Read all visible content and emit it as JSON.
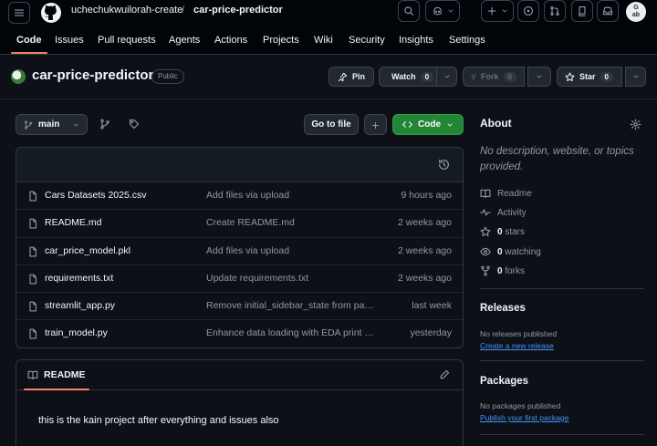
{
  "header": {
    "owner": "uchechukwuilorah-create",
    "separator": "/",
    "repo": "car-price-predictor",
    "avatar_lines": [
      "G",
      "ab"
    ]
  },
  "nav": {
    "tabs": [
      "Code",
      "Issues",
      "Pull requests",
      "Agents",
      "Actions",
      "Projects",
      "Wiki",
      "Security",
      "Insights",
      "Settings"
    ],
    "active": "Code"
  },
  "repo": {
    "name": "car-price-predictor",
    "visibility": "Public",
    "pin_label": "Pin",
    "watch_label": "Watch",
    "watch_count": "0",
    "fork_label": "Fork",
    "fork_count": "0",
    "star_label": "Star",
    "star_count": "0"
  },
  "toolbar": {
    "branch": "main",
    "goto_file": "Go to file",
    "plus": "+",
    "code_label": "Code"
  },
  "files": [
    {
      "name": "Cars Datasets 2025.csv",
      "message": "Add files via upload",
      "date": "9 hours ago"
    },
    {
      "name": "README.md",
      "message": "Create README.md",
      "date": "2 weeks ago"
    },
    {
      "name": "car_price_model.pkl",
      "message": "Add files via upload",
      "date": "2 weeks ago"
    },
    {
      "name": "requirements.txt",
      "message": "Update requirements.txt",
      "date": "2 weeks ago"
    },
    {
      "name": "streamlit_app.py",
      "message": "Remove initial_sidebar_state from page config",
      "date": "last week"
    },
    {
      "name": "train_model.py",
      "message": "Enhance data loading with EDA print statements",
      "date": "yesterday"
    }
  ],
  "readme": {
    "tab_label": "README",
    "body": "this is the kain project after everything and issues also"
  },
  "sidebar": {
    "about_title": "About",
    "about_desc": "No description, website, or topics provided.",
    "readme_link": "Readme",
    "activity_link": "Activity",
    "stars_count": "0",
    "stars_label": "stars",
    "watching_count": "0",
    "watching_label": "watching",
    "forks_count": "0",
    "forks_label": "forks",
    "releases_title": "Releases",
    "releases_note": "No releases published",
    "releases_link": "Create a new release",
    "packages_title": "Packages",
    "packages_note": "No packages published",
    "packages_link": "Publish your first package"
  },
  "colors": {
    "background": "#0d1117",
    "header": "#010409",
    "accent_underline": "#f78166",
    "code_button": "#238636",
    "link": "#4493f8"
  }
}
